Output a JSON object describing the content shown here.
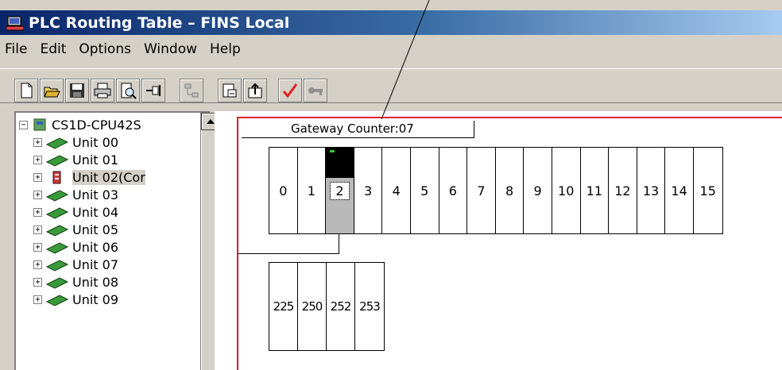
{
  "window": {
    "title": "PLC Routing Table – FINS Local"
  },
  "menu": [
    "File",
    "Edit",
    "Options",
    "Window",
    "Help"
  ],
  "toolbar": {
    "buttons": [
      "new-icon",
      "open-icon",
      "save-icon",
      "print-icon",
      "print-preview-icon",
      "pin-icon",
      "network-icon",
      "import-icon",
      "export-icon",
      "check-icon",
      "transfer-icon"
    ]
  },
  "tree": {
    "root": "CS1D-CPU42S",
    "items": [
      "Unit 00",
      "Unit 01",
      "Unit 02(Cor",
      "Unit 03",
      "Unit 04",
      "Unit 05",
      "Unit 06",
      "Unit 07",
      "Unit 08",
      "Unit 09"
    ]
  },
  "gateway": {
    "label": "Gateway Counter:07"
  },
  "slots": [
    "0",
    "1",
    "2",
    "3",
    "4",
    "5",
    "6",
    "7",
    "8",
    "9",
    "10",
    "11",
    "12",
    "13",
    "14",
    "15"
  ],
  "selected_slot": "2",
  "networks": [
    "225",
    "250",
    "252",
    "253"
  ]
}
